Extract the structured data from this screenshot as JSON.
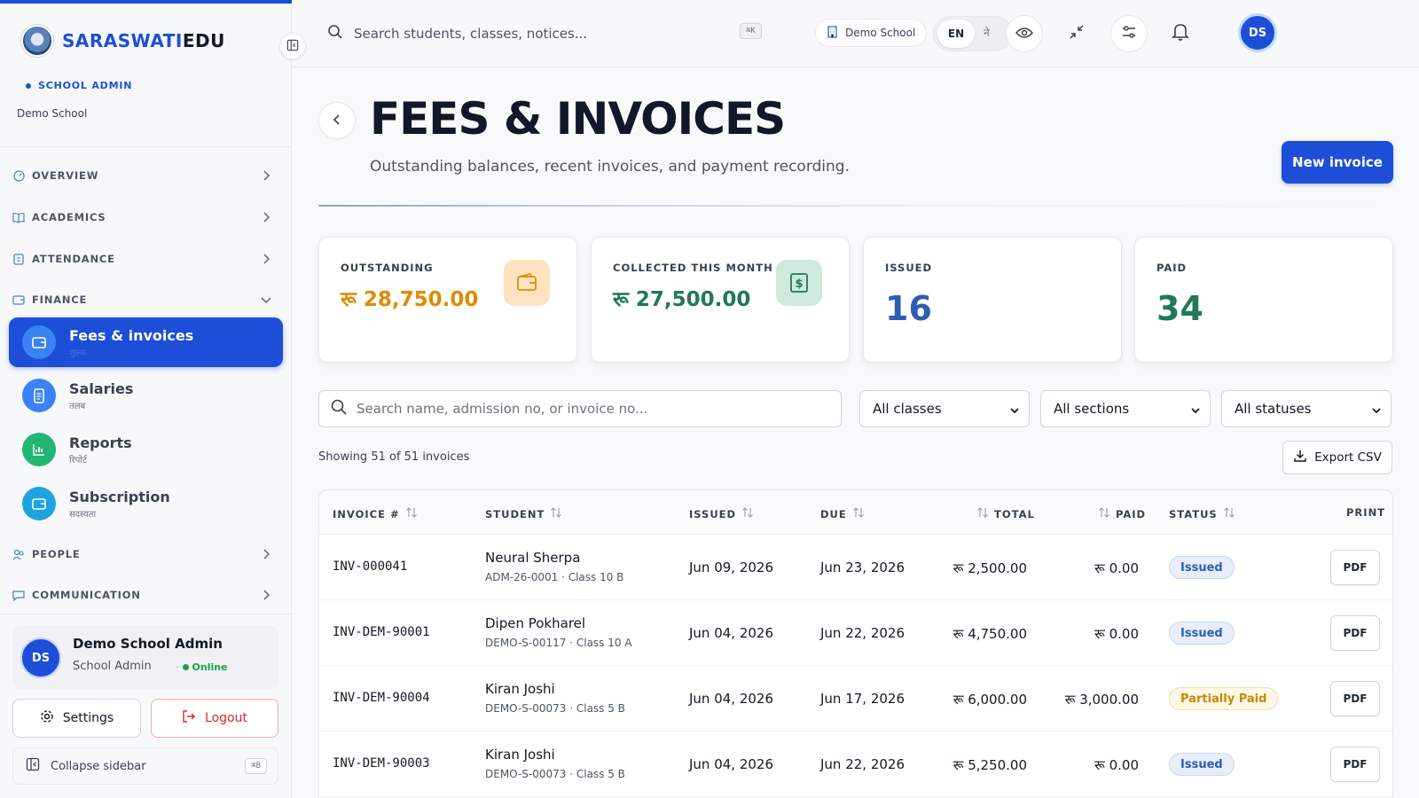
{
  "brand": {
    "part1": "SARASWATI",
    "part2": "EDU"
  },
  "sidebar": {
    "role": "SCHOOL ADMIN",
    "school": "Demo School",
    "groups": [
      {
        "label": "OVERVIEW",
        "icon": "gauge-icon"
      },
      {
        "label": "ACADEMICS",
        "icon": "book-icon"
      },
      {
        "label": "ATTENDANCE",
        "icon": "clipboard-icon"
      },
      {
        "label": "FINANCE",
        "icon": "wallet-icon"
      },
      {
        "label": "PEOPLE",
        "icon": "users-icon"
      },
      {
        "label": "COMMUNICATION",
        "icon": "message-icon"
      }
    ],
    "finance_items": [
      {
        "label": "Fees & invoices",
        "sub": "शुल्क",
        "active": true
      },
      {
        "label": "Salaries",
        "sub": "तलब",
        "active": false
      },
      {
        "label": "Reports",
        "sub": "रिपोर्ट",
        "active": false
      },
      {
        "label": "Subscription",
        "sub": "सदस्यता",
        "active": false
      }
    ],
    "user": {
      "initials": "DS",
      "name": "Demo School Admin",
      "role": "School Admin",
      "status": "Online"
    },
    "settings_label": "Settings",
    "logout_label": "Logout",
    "collapse_label": "Collapse sidebar",
    "collapse_kbd": "⌘B"
  },
  "header": {
    "search_placeholder": "Search students, classes, notices...",
    "search_kbd": "⌘K",
    "school_pill": "Demo School",
    "lang_en": "EN",
    "lang_ne": "ने",
    "avatar": "DS"
  },
  "page": {
    "title": "FEES & INVOICES",
    "subtitle": "Outstanding balances, recent invoices, and payment recording.",
    "new_invoice": "New invoice"
  },
  "stats": [
    {
      "label": "OUTSTANDING",
      "value": "रू 28,750.00",
      "color": "#e08a00",
      "icon": "wallet-icon"
    },
    {
      "label": "COLLECTED THIS MONTH",
      "value": "रू 27,500.00",
      "color": "#1f7a55",
      "icon": "cash-icon"
    },
    {
      "label": "ISSUED",
      "value": "16",
      "color": "#2b5fb3"
    },
    {
      "label": "PAID",
      "value": "34",
      "color": "#1f7a55"
    }
  ],
  "filters": {
    "search_placeholder": "Search name, admission no, or invoice no...",
    "classes": "All classes",
    "sections": "All sections",
    "statuses": "All statuses"
  },
  "showing": "Showing 51 of 51 invoices",
  "export_label": "Export CSV",
  "table": {
    "headers": {
      "invoice": "INVOICE #",
      "student": "STUDENT",
      "issued": "ISSUED",
      "due": "DUE",
      "total": "TOTAL",
      "paid": "PAID",
      "status": "STATUS",
      "print": "PRINT"
    },
    "rows": [
      {
        "invoice": "INV-000041",
        "name": "Neural Sherpa",
        "sub": "ADM-26-0001 · Class 10 B",
        "issued": "Jun 09, 2026",
        "due": "Jun 23, 2026",
        "total": "रू 2,500.00",
        "paid": "रू 0.00",
        "status": "Issued",
        "status_kind": "issued",
        "print": "PDF"
      },
      {
        "invoice": "INV-DEM-90001",
        "name": "Dipen Pokharel",
        "sub": "DEMO-S-00117 · Class 10 A",
        "issued": "Jun 04, 2026",
        "due": "Jun 22, 2026",
        "total": "रू 4,750.00",
        "paid": "रू 0.00",
        "status": "Issued",
        "status_kind": "issued",
        "print": "PDF"
      },
      {
        "invoice": "INV-DEM-90004",
        "name": "Kiran Joshi",
        "sub": "DEMO-S-00073 · Class 5 B",
        "issued": "Jun 04, 2026",
        "due": "Jun 17, 2026",
        "total": "रू 6,000.00",
        "paid": "रू 3,000.00",
        "status": "Partially Paid",
        "status_kind": "partial",
        "print": "PDF"
      },
      {
        "invoice": "INV-DEM-90003",
        "name": "Kiran Joshi",
        "sub": "DEMO-S-00073 · Class 5 B",
        "issued": "Jun 04, 2026",
        "due": "Jun 22, 2026",
        "total": "रू 5,250.00",
        "paid": "रू 0.00",
        "status": "Issued",
        "status_kind": "issued",
        "print": "PDF"
      }
    ]
  }
}
